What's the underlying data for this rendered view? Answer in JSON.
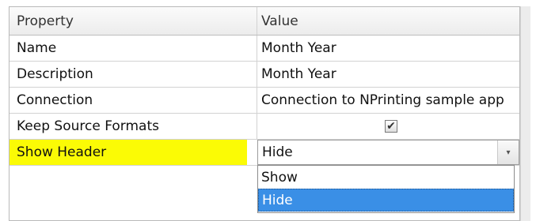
{
  "table": {
    "headers": {
      "property": "Property",
      "value": "Value"
    },
    "rows": [
      {
        "property": "Name",
        "value": "Month Year"
      },
      {
        "property": "Description",
        "value": "Month Year"
      },
      {
        "property": "Connection",
        "value": "Connection to NPrinting sample app"
      },
      {
        "property": "Keep Source Formats",
        "checkbox_checked": true,
        "check_glyph": "✔"
      },
      {
        "property": "Show Header",
        "value": "Hide",
        "highlight_color": "#fbfb05"
      }
    ]
  },
  "dropdown": {
    "arrow_glyph": "▾",
    "options": [
      "Show",
      "Hide"
    ],
    "selected_option": "Hide",
    "selected_color": "#3a8fe6"
  }
}
